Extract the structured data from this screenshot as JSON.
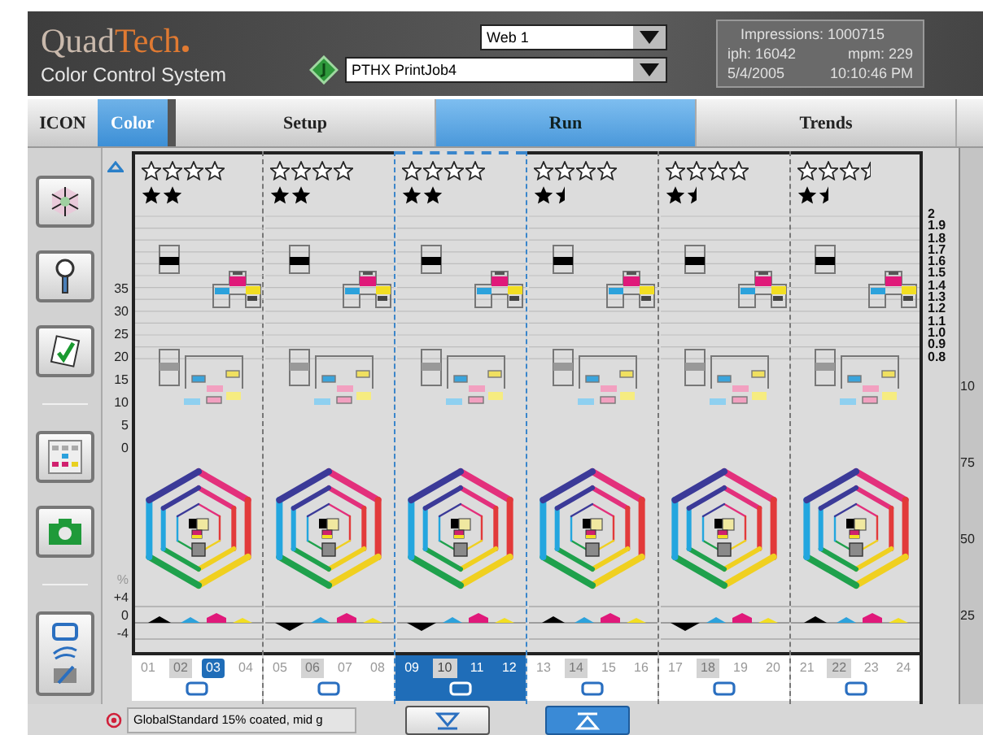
{
  "header": {
    "logo_a": "Quad",
    "logo_b": "Tech",
    "subtitle": "Color Control System",
    "web_select": "Web 1",
    "job_select": "PTHX PrintJob4",
    "info": {
      "impressions": "Impressions: 1000715",
      "iph": "iph: 16042",
      "mpm": "mpm: 229",
      "date": "5/4/2005",
      "time": "10:10:46 PM"
    }
  },
  "mode_tabs": [
    {
      "label": "ICON",
      "selected": false
    },
    {
      "label": "Color",
      "selected": true
    }
  ],
  "tabs": [
    {
      "label": "Setup",
      "selected": false
    },
    {
      "label": "Run",
      "selected": true
    },
    {
      "label": "Trends",
      "selected": false
    }
  ],
  "density_axis": [
    "35",
    "30",
    "25",
    "20",
    "15",
    "10",
    "5",
    "0"
  ],
  "deviation_axis": [
    "%",
    "+4",
    "0",
    "-4"
  ],
  "right_axis": [
    "2",
    "1.9",
    "1.8",
    "1.7",
    "1.6",
    "1.5",
    "1.4",
    "1.3",
    "1.2",
    "1.1",
    "1.0",
    "0.9",
    "0.8"
  ],
  "units": [
    {
      "selected": false,
      "black_below": false,
      "star_rows": [
        {
          "kind": "outline",
          "marks": [
            {
              "half": false
            },
            {
              "half": false
            },
            {
              "half": false
            },
            {
              "half": false
            }
          ]
        },
        {
          "kind": "solid",
          "marks": [
            {
              "half": false
            },
            {
              "half": false
            }
          ]
        }
      ],
      "zones": [
        {
          "label": "01",
          "shaded": false,
          "selected": false
        },
        {
          "label": "02",
          "shaded": true,
          "selected": false
        },
        {
          "label": "03",
          "shaded": false,
          "selected": true
        },
        {
          "label": "04",
          "shaded": false,
          "selected": false
        }
      ]
    },
    {
      "selected": false,
      "black_below": true,
      "star_rows": [
        {
          "kind": "outline",
          "marks": [
            {
              "half": false
            },
            {
              "half": false
            },
            {
              "half": false
            },
            {
              "half": false
            }
          ]
        },
        {
          "kind": "solid",
          "marks": [
            {
              "half": false
            },
            {
              "half": false
            }
          ]
        }
      ],
      "zones": [
        {
          "label": "05",
          "shaded": false,
          "selected": false
        },
        {
          "label": "06",
          "shaded": true,
          "selected": false
        },
        {
          "label": "07",
          "shaded": false,
          "selected": false
        },
        {
          "label": "08",
          "shaded": false,
          "selected": false
        }
      ]
    },
    {
      "selected": true,
      "black_below": true,
      "star_rows": [
        {
          "kind": "outline",
          "marks": [
            {
              "half": false
            },
            {
              "half": false
            },
            {
              "half": false
            },
            {
              "half": false
            }
          ]
        },
        {
          "kind": "solid",
          "marks": [
            {
              "half": false
            },
            {
              "half": false
            }
          ]
        }
      ],
      "zones": [
        {
          "label": "09",
          "shaded": false,
          "selected": false
        },
        {
          "label": "10",
          "shaded": true,
          "selected": false
        },
        {
          "label": "11",
          "shaded": false,
          "selected": false
        },
        {
          "label": "12",
          "shaded": false,
          "selected": false
        }
      ]
    },
    {
      "selected": false,
      "black_below": false,
      "star_rows": [
        {
          "kind": "outline",
          "marks": [
            {
              "half": false
            },
            {
              "half": false
            },
            {
              "half": false
            },
            {
              "half": false
            }
          ]
        },
        {
          "kind": "solid",
          "marks": [
            {
              "half": false
            },
            {
              "half": true
            }
          ]
        }
      ],
      "zones": [
        {
          "label": "13",
          "shaded": false,
          "selected": false
        },
        {
          "label": "14",
          "shaded": true,
          "selected": false
        },
        {
          "label": "15",
          "shaded": false,
          "selected": false
        },
        {
          "label": "16",
          "shaded": false,
          "selected": false
        }
      ]
    },
    {
      "selected": false,
      "black_below": true,
      "star_rows": [
        {
          "kind": "outline",
          "marks": [
            {
              "half": false
            },
            {
              "half": false
            },
            {
              "half": false
            },
            {
              "half": false
            }
          ]
        },
        {
          "kind": "solid",
          "marks": [
            {
              "half": false
            },
            {
              "half": true
            }
          ]
        }
      ],
      "zones": [
        {
          "label": "17",
          "shaded": false,
          "selected": false
        },
        {
          "label": "18",
          "shaded": true,
          "selected": false
        },
        {
          "label": "19",
          "shaded": false,
          "selected": false
        },
        {
          "label": "20",
          "shaded": false,
          "selected": false
        }
      ]
    },
    {
      "selected": false,
      "black_below": false,
      "star_rows": [
        {
          "kind": "outline",
          "marks": [
            {
              "half": false
            },
            {
              "half": false
            },
            {
              "half": false
            },
            {
              "half": true
            }
          ]
        },
        {
          "kind": "solid",
          "marks": [
            {
              "half": false
            },
            {
              "half": true
            }
          ]
        }
      ],
      "zones": [
        {
          "label": "21",
          "shaded": false,
          "selected": false
        },
        {
          "label": "22",
          "shaded": true,
          "selected": false
        },
        {
          "label": "23",
          "shaded": false,
          "selected": false
        },
        {
          "label": "24",
          "shaded": false,
          "selected": false
        }
      ]
    }
  ],
  "side_panel_labels": [
    "10",
    "75",
    "50",
    "25"
  ],
  "status": {
    "profile": "GlobalStandard 15% coated, mid g"
  },
  "nav_buttons": [
    {
      "kind": "down",
      "selected": false
    },
    {
      "kind": "up",
      "selected": true
    }
  ]
}
